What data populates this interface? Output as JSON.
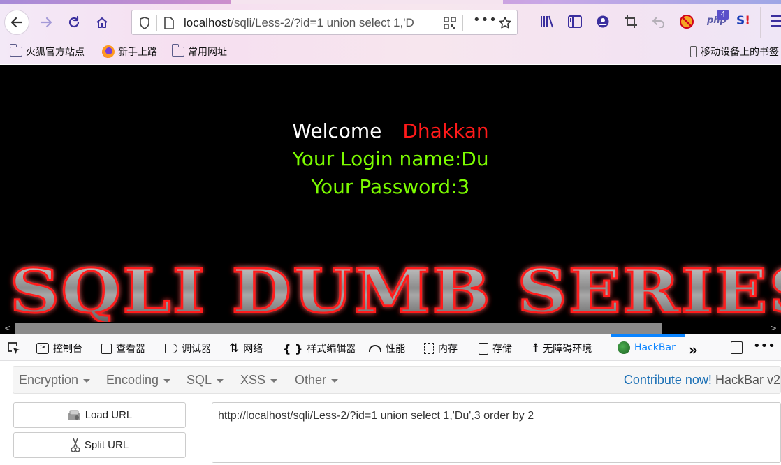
{
  "browser": {
    "url_host": "localhost",
    "url_path": "/sqli/Less-2/?id=1 union select 1,'D",
    "bookmarks": [
      "火狐官方站点",
      "新手上路",
      "常用网址"
    ],
    "mobile_bookmarks": "移动设备上的书签",
    "php_badge": "4"
  },
  "page": {
    "welcome_label": "Welcome",
    "welcome_name": "Dhakkan",
    "login_line": "Your Login name:Du",
    "password_line": "Your Password:3",
    "banner_text": "SQLI DUMB SERIES"
  },
  "devtools": {
    "tabs": [
      "控制台",
      "查看器",
      "调试器",
      "网络",
      "样式编辑器",
      "性能",
      "内存",
      "存储",
      "无障碍环境",
      "HackBar"
    ]
  },
  "hackbar": {
    "menu": [
      "Encryption",
      "Encoding",
      "SQL",
      "XSS",
      "Other"
    ],
    "contribute": "Contribute now!",
    "version": "HackBar v2",
    "load_url": "Load URL",
    "split_url": "Split URL",
    "url_value": "http://localhost/sqli/Less-2/?id=1 union select 1,'Du',3 order by 2"
  },
  "colors": {
    "welcome_name": "#ff1a1a",
    "login_text": "#7cfc00",
    "hackbar_active": "#0a84ff"
  }
}
